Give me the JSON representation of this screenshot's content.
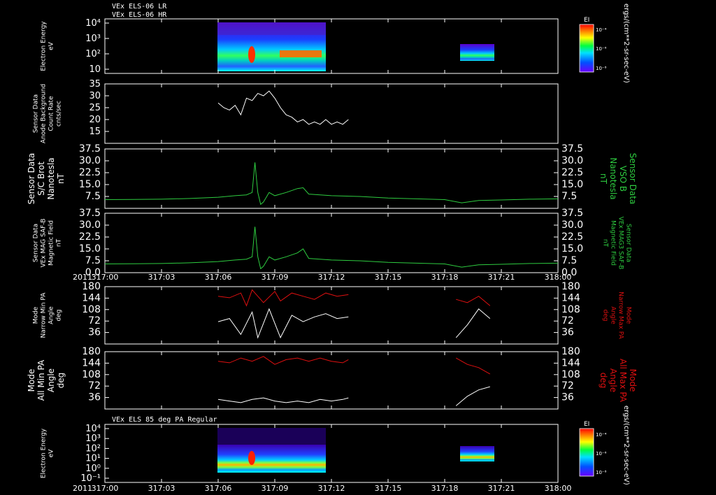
{
  "headers": {
    "top_lr": "VEx ELS-06 LR",
    "top_hr": "VEx ELS-06 HR",
    "bottom": "VEx ELS 85 deg PA Regular"
  },
  "colors": {
    "background": "#000000",
    "axis": "#ffffff",
    "white_trace": "#ffffff",
    "green_trace": "#2ecc40",
    "red_trace": "#e01010"
  },
  "colorbar": {
    "label": "EI",
    "units": "ergs/(cm**2-sr-sec-eV)",
    "ticks": [
      "10⁻⁴",
      "10⁻⁶",
      "10⁻⁸"
    ]
  },
  "xaxis": {
    "year": "2011",
    "ticks": [
      "317:00",
      "317:03",
      "317:06",
      "317:09",
      "317:12",
      "317:15",
      "317:18",
      "317:21",
      "318:00"
    ]
  },
  "chart_data": [
    {
      "type": "heatmap",
      "panel": "electron-energy-lr-hr",
      "ylabel": [
        "Electron Energy",
        "eV"
      ],
      "yscale": "log",
      "yticks": [
        "10⁴",
        "10³",
        "10²",
        "10"
      ],
      "segments": [
        {
          "start_tick": 2.0,
          "end_tick": 3.3
        },
        {
          "start_tick": 6.2,
          "end_tick": 6.8
        }
      ]
    },
    {
      "type": "line",
      "panel": "background-count-rate",
      "ylabel": [
        "Sensor Data",
        "Anode Background",
        "Count Rate",
        "cnts/sec"
      ],
      "yticks": [
        "35",
        "30",
        "25",
        "20",
        "15"
      ],
      "ylim": [
        10,
        35
      ],
      "series": [
        {
          "color": "white_trace",
          "points": [
            [
              2.0,
              27
            ],
            [
              2.1,
              25
            ],
            [
              2.2,
              24
            ],
            [
              2.3,
              26
            ],
            [
              2.4,
              22
            ],
            [
              2.5,
              29
            ],
            [
              2.6,
              28
            ],
            [
              2.7,
              31
            ],
            [
              2.8,
              30
            ],
            [
              2.9,
              32
            ],
            [
              3.0,
              29
            ],
            [
              3.1,
              25
            ],
            [
              3.2,
              22
            ],
            [
              3.3,
              21
            ],
            [
              3.4,
              19
            ],
            [
              3.5,
              20
            ],
            [
              3.6,
              18
            ],
            [
              3.7,
              19
            ],
            [
              3.8,
              18
            ],
            [
              3.9,
              20
            ],
            [
              4.0,
              18
            ],
            [
              4.1,
              19
            ],
            [
              4.2,
              18
            ],
            [
              4.3,
              20
            ]
          ]
        }
      ]
    },
    {
      "type": "line",
      "panel": "sc-brot",
      "ylabel": [
        "Sensor Data",
        "S/C Brot",
        "Nanotesla",
        "nT"
      ],
      "ylabel_right": [
        "Sensor Data",
        "VSO B",
        "Nanotesla",
        "nT"
      ],
      "yticks": [
        "37.5",
        "30.0",
        "22.5",
        "15.0",
        "7.5"
      ],
      "ylim": [
        0,
        37.5
      ],
      "series": [
        {
          "color": "green_trace",
          "points": [
            [
              0,
              5.5
            ],
            [
              0.5,
              5.6
            ],
            [
              1.0,
              5.8
            ],
            [
              1.5,
              6.2
            ],
            [
              2.0,
              7.0
            ],
            [
              2.3,
              8.0
            ],
            [
              2.5,
              8.5
            ],
            [
              2.6,
              10.0
            ],
            [
              2.65,
              29.0
            ],
            [
              2.7,
              10.0
            ],
            [
              2.75,
              2.5
            ],
            [
              2.8,
              4.0
            ],
            [
              2.9,
              10.0
            ],
            [
              3.0,
              8.0
            ],
            [
              3.2,
              10.0
            ],
            [
              3.4,
              12.5
            ],
            [
              3.5,
              13.0
            ],
            [
              3.6,
              9.0
            ],
            [
              3.8,
              8.5
            ],
            [
              4.0,
              8.0
            ],
            [
              4.5,
              7.5
            ],
            [
              5.0,
              6.5
            ],
            [
              5.5,
              6.0
            ],
            [
              6.0,
              5.5
            ],
            [
              6.3,
              3.5
            ],
            [
              6.6,
              5.0
            ],
            [
              7.0,
              5.3
            ],
            [
              7.5,
              5.8
            ],
            [
              8.0,
              6.0
            ]
          ]
        }
      ]
    },
    {
      "type": "line",
      "panel": "mag3-saf-b",
      "ylabel": [
        "Sensor Data",
        "VEx MAG SAF-B",
        "Magnetic Field",
        "nT"
      ],
      "ylabel_right": [
        "Sensor Data",
        "VEx MAG3 SAF-B",
        "Magnetic Field",
        "nT"
      ],
      "yticks": [
        "37.5",
        "30.0",
        "22.5",
        "15.0",
        "7.5",
        "0.0"
      ],
      "ylim": [
        0,
        37.5
      ],
      "series": [
        {
          "color": "green_trace",
          "points": [
            [
              0,
              5.5
            ],
            [
              0.5,
              5.6
            ],
            [
              1.0,
              5.8
            ],
            [
              1.5,
              6.2
            ],
            [
              2.0,
              7.0
            ],
            [
              2.3,
              8.0
            ],
            [
              2.5,
              8.5
            ],
            [
              2.6,
              10.0
            ],
            [
              2.65,
              29.0
            ],
            [
              2.7,
              10.0
            ],
            [
              2.75,
              2.5
            ],
            [
              2.8,
              4.0
            ],
            [
              2.9,
              10.0
            ],
            [
              3.0,
              8.0
            ],
            [
              3.2,
              10.0
            ],
            [
              3.4,
              12.5
            ],
            [
              3.5,
              15.0
            ],
            [
              3.6,
              9.0
            ],
            [
              3.8,
              8.5
            ],
            [
              4.0,
              8.0
            ],
            [
              4.5,
              7.5
            ],
            [
              5.0,
              6.5
            ],
            [
              5.5,
              6.0
            ],
            [
              6.0,
              5.5
            ],
            [
              6.3,
              3.5
            ],
            [
              6.6,
              5.0
            ],
            [
              7.0,
              5.3
            ],
            [
              7.5,
              5.8
            ],
            [
              8.0,
              6.0
            ]
          ]
        }
      ]
    },
    {
      "type": "line",
      "panel": "narrow-pa",
      "ylabel": [
        "Mode",
        "Narrow Min PA",
        "Angle",
        "deg"
      ],
      "ylabel_right": [
        "Mode",
        "Narrow Max PA",
        "Angle",
        "deg"
      ],
      "yticks": [
        "180",
        "144",
        "108",
        "72",
        "36"
      ],
      "ylim": [
        0,
        180
      ],
      "series": [
        {
          "name": "Max PA",
          "color": "red_trace",
          "points": [
            [
              2.0,
              150
            ],
            [
              2.2,
              145
            ],
            [
              2.4,
              160
            ],
            [
              2.5,
              120
            ],
            [
              2.6,
              170
            ],
            [
              2.8,
              130
            ],
            [
              3.0,
              165
            ],
            [
              3.1,
              135
            ],
            [
              3.3,
              160
            ],
            [
              3.5,
              150
            ],
            [
              3.7,
              140
            ],
            [
              3.9,
              160
            ],
            [
              4.1,
              150
            ],
            [
              4.3,
              155
            ],
            [
              6.2,
              140
            ],
            [
              6.4,
              130
            ],
            [
              6.6,
              150
            ],
            [
              6.8,
              120
            ]
          ]
        },
        {
          "name": "Min PA",
          "color": "white_trace",
          "points": [
            [
              2.0,
              70
            ],
            [
              2.2,
              80
            ],
            [
              2.4,
              30
            ],
            [
              2.6,
              100
            ],
            [
              2.7,
              20
            ],
            [
              2.9,
              110
            ],
            [
              3.1,
              20
            ],
            [
              3.3,
              90
            ],
            [
              3.5,
              70
            ],
            [
              3.7,
              85
            ],
            [
              3.9,
              95
            ],
            [
              4.1,
              80
            ],
            [
              4.3,
              85
            ],
            [
              6.2,
              20
            ],
            [
              6.4,
              60
            ],
            [
              6.6,
              110
            ],
            [
              6.8,
              80
            ]
          ]
        }
      ]
    },
    {
      "type": "line",
      "panel": "all-pa",
      "ylabel": [
        "Mode",
        "All Min PA",
        "Angle",
        "deg"
      ],
      "ylabel_right": [
        "Mode",
        "All Max PA",
        "Angle",
        "deg"
      ],
      "yticks": [
        "180",
        "144",
        "108",
        "72",
        "36"
      ],
      "ylim": [
        0,
        180
      ],
      "series": [
        {
          "name": "Max PA",
          "color": "red_trace",
          "points": [
            [
              2.0,
              150
            ],
            [
              2.2,
              145
            ],
            [
              2.4,
              160
            ],
            [
              2.6,
              150
            ],
            [
              2.8,
              165
            ],
            [
              3.0,
              140
            ],
            [
              3.2,
              155
            ],
            [
              3.4,
              160
            ],
            [
              3.6,
              150
            ],
            [
              3.8,
              160
            ],
            [
              4.0,
              150
            ],
            [
              4.2,
              145
            ],
            [
              4.3,
              155
            ],
            [
              6.2,
              160
            ],
            [
              6.4,
              140
            ],
            [
              6.6,
              130
            ],
            [
              6.8,
              110
            ]
          ]
        },
        {
          "name": "Min PA",
          "color": "white_trace",
          "points": [
            [
              2.0,
              30
            ],
            [
              2.2,
              25
            ],
            [
              2.4,
              20
            ],
            [
              2.6,
              30
            ],
            [
              2.8,
              35
            ],
            [
              3.0,
              25
            ],
            [
              3.2,
              20
            ],
            [
              3.4,
              25
            ],
            [
              3.6,
              20
            ],
            [
              3.8,
              30
            ],
            [
              4.0,
              25
            ],
            [
              4.2,
              30
            ],
            [
              4.3,
              35
            ],
            [
              6.2,
              10
            ],
            [
              6.4,
              40
            ],
            [
              6.6,
              60
            ],
            [
              6.8,
              70
            ]
          ]
        }
      ]
    },
    {
      "type": "heatmap",
      "panel": "electron-energy-85pa",
      "ylabel": [
        "Electron Energy",
        "eV"
      ],
      "yscale": "log",
      "yticks": [
        "10⁴",
        "10³",
        "10²",
        "10¹",
        "10⁰",
        "10⁻¹"
      ],
      "segments": [
        {
          "start_tick": 2.0,
          "end_tick": 4.3
        },
        {
          "start_tick": 6.2,
          "end_tick": 6.8
        }
      ]
    }
  ]
}
